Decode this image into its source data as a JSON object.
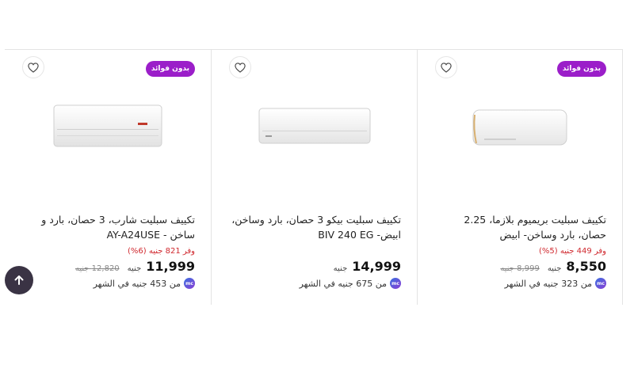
{
  "products": [
    {
      "badge": "بدون فوائد",
      "title": "تكييف سبليت بريميوم بلازما، 2.25 حصان، بارد وساخن- ابيض",
      "savings": "وفر 449 جنيه (5%)",
      "price": "8,550",
      "currency": "جنيه",
      "old_price": "8,999 جنيه",
      "installment": "من 323 جنيه في الشهر",
      "mc_label": "mc"
    },
    {
      "badge": "",
      "title": "تكييف سبليت بيكو 3 حصان، بارد وساخن، ابيض- BIV 240 EG",
      "savings": "",
      "price": "14,999",
      "currency": "جنيه",
      "old_price": "",
      "installment": "من 675 جنيه في الشهر",
      "mc_label": "mc"
    },
    {
      "badge": "بدون فوائد",
      "title": "تكييف سبليت شارب، 3 حصان، بارد و ساخن - AY-A24USE",
      "savings": "وفر 821 جنيه (6%)",
      "price": "11,999",
      "currency": "جنيه",
      "old_price": "12,820 جنيه",
      "installment": "من 453 جنيه في الشهر",
      "mc_label": "mc"
    }
  ],
  "colors": {
    "badge": "#9b1ec9",
    "savings": "#d0282e",
    "scroll_button": "#3a3344"
  },
  "icons": {
    "wishlist": "heart-icon",
    "scroll": "arrow-up-icon"
  }
}
